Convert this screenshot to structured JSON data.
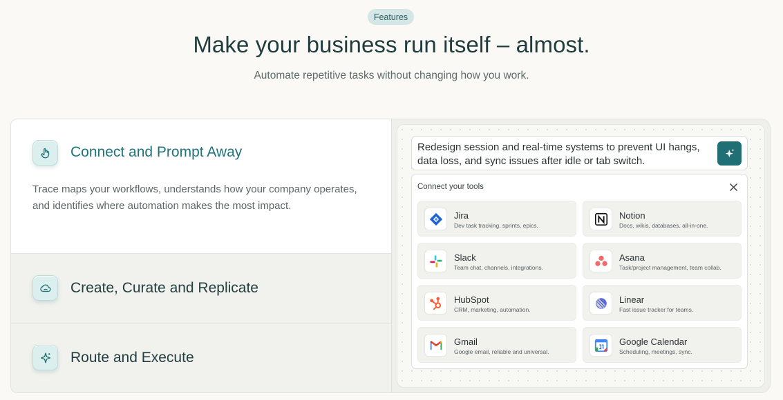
{
  "header": {
    "badge": "Features",
    "title": "Make your business run itself – almost.",
    "subtitle": "Automate repetitive tasks without changing how you work."
  },
  "features": [
    {
      "title": "Connect and Prompt Away",
      "icon": "hand-pointer-icon",
      "active": true,
      "description": "Trace maps your workflows, understands how your company operates, and identifies where automation makes the most impact."
    },
    {
      "title": "Create, Curate and Replicate",
      "icon": "cloud-icon",
      "active": false
    },
    {
      "title": "Route and Execute",
      "icon": "sparkle-icon",
      "active": false
    }
  ],
  "prompt": {
    "text": "Redesign session and real-time systems to prevent UI hangs, data loss, and sync issues after idle or tab switch.",
    "button_icon": "sparkle-icon"
  },
  "tools_panel": {
    "title": "Connect your tools",
    "close_icon": "close-icon",
    "tools": [
      {
        "name": "Jira",
        "description": "Dev task tracking, sprints, epics.",
        "icon": "jira-icon"
      },
      {
        "name": "Notion",
        "description": "Docs, wikis, databases, all-in-one.",
        "icon": "notion-icon"
      },
      {
        "name": "Slack",
        "description": "Team chat, channels, integrations.",
        "icon": "slack-icon"
      },
      {
        "name": "Asana",
        "description": "Task/project management, team collab.",
        "icon": "asana-icon"
      },
      {
        "name": "HubSpot",
        "description": "CRM, marketing, automation.",
        "icon": "hubspot-icon"
      },
      {
        "name": "Linear",
        "description": "Fast issue tracker for teams.",
        "icon": "linear-icon"
      },
      {
        "name": "Gmail",
        "description": "Google email, reliable and universal.",
        "icon": "gmail-icon"
      },
      {
        "name": "Google Calendar",
        "description": "Scheduling, meetings, sync.",
        "icon": "google-calendar-icon"
      }
    ]
  },
  "colors": {
    "accent": "#1f6f74",
    "active_title": "#1f7479",
    "background": "#faf9f5"
  }
}
